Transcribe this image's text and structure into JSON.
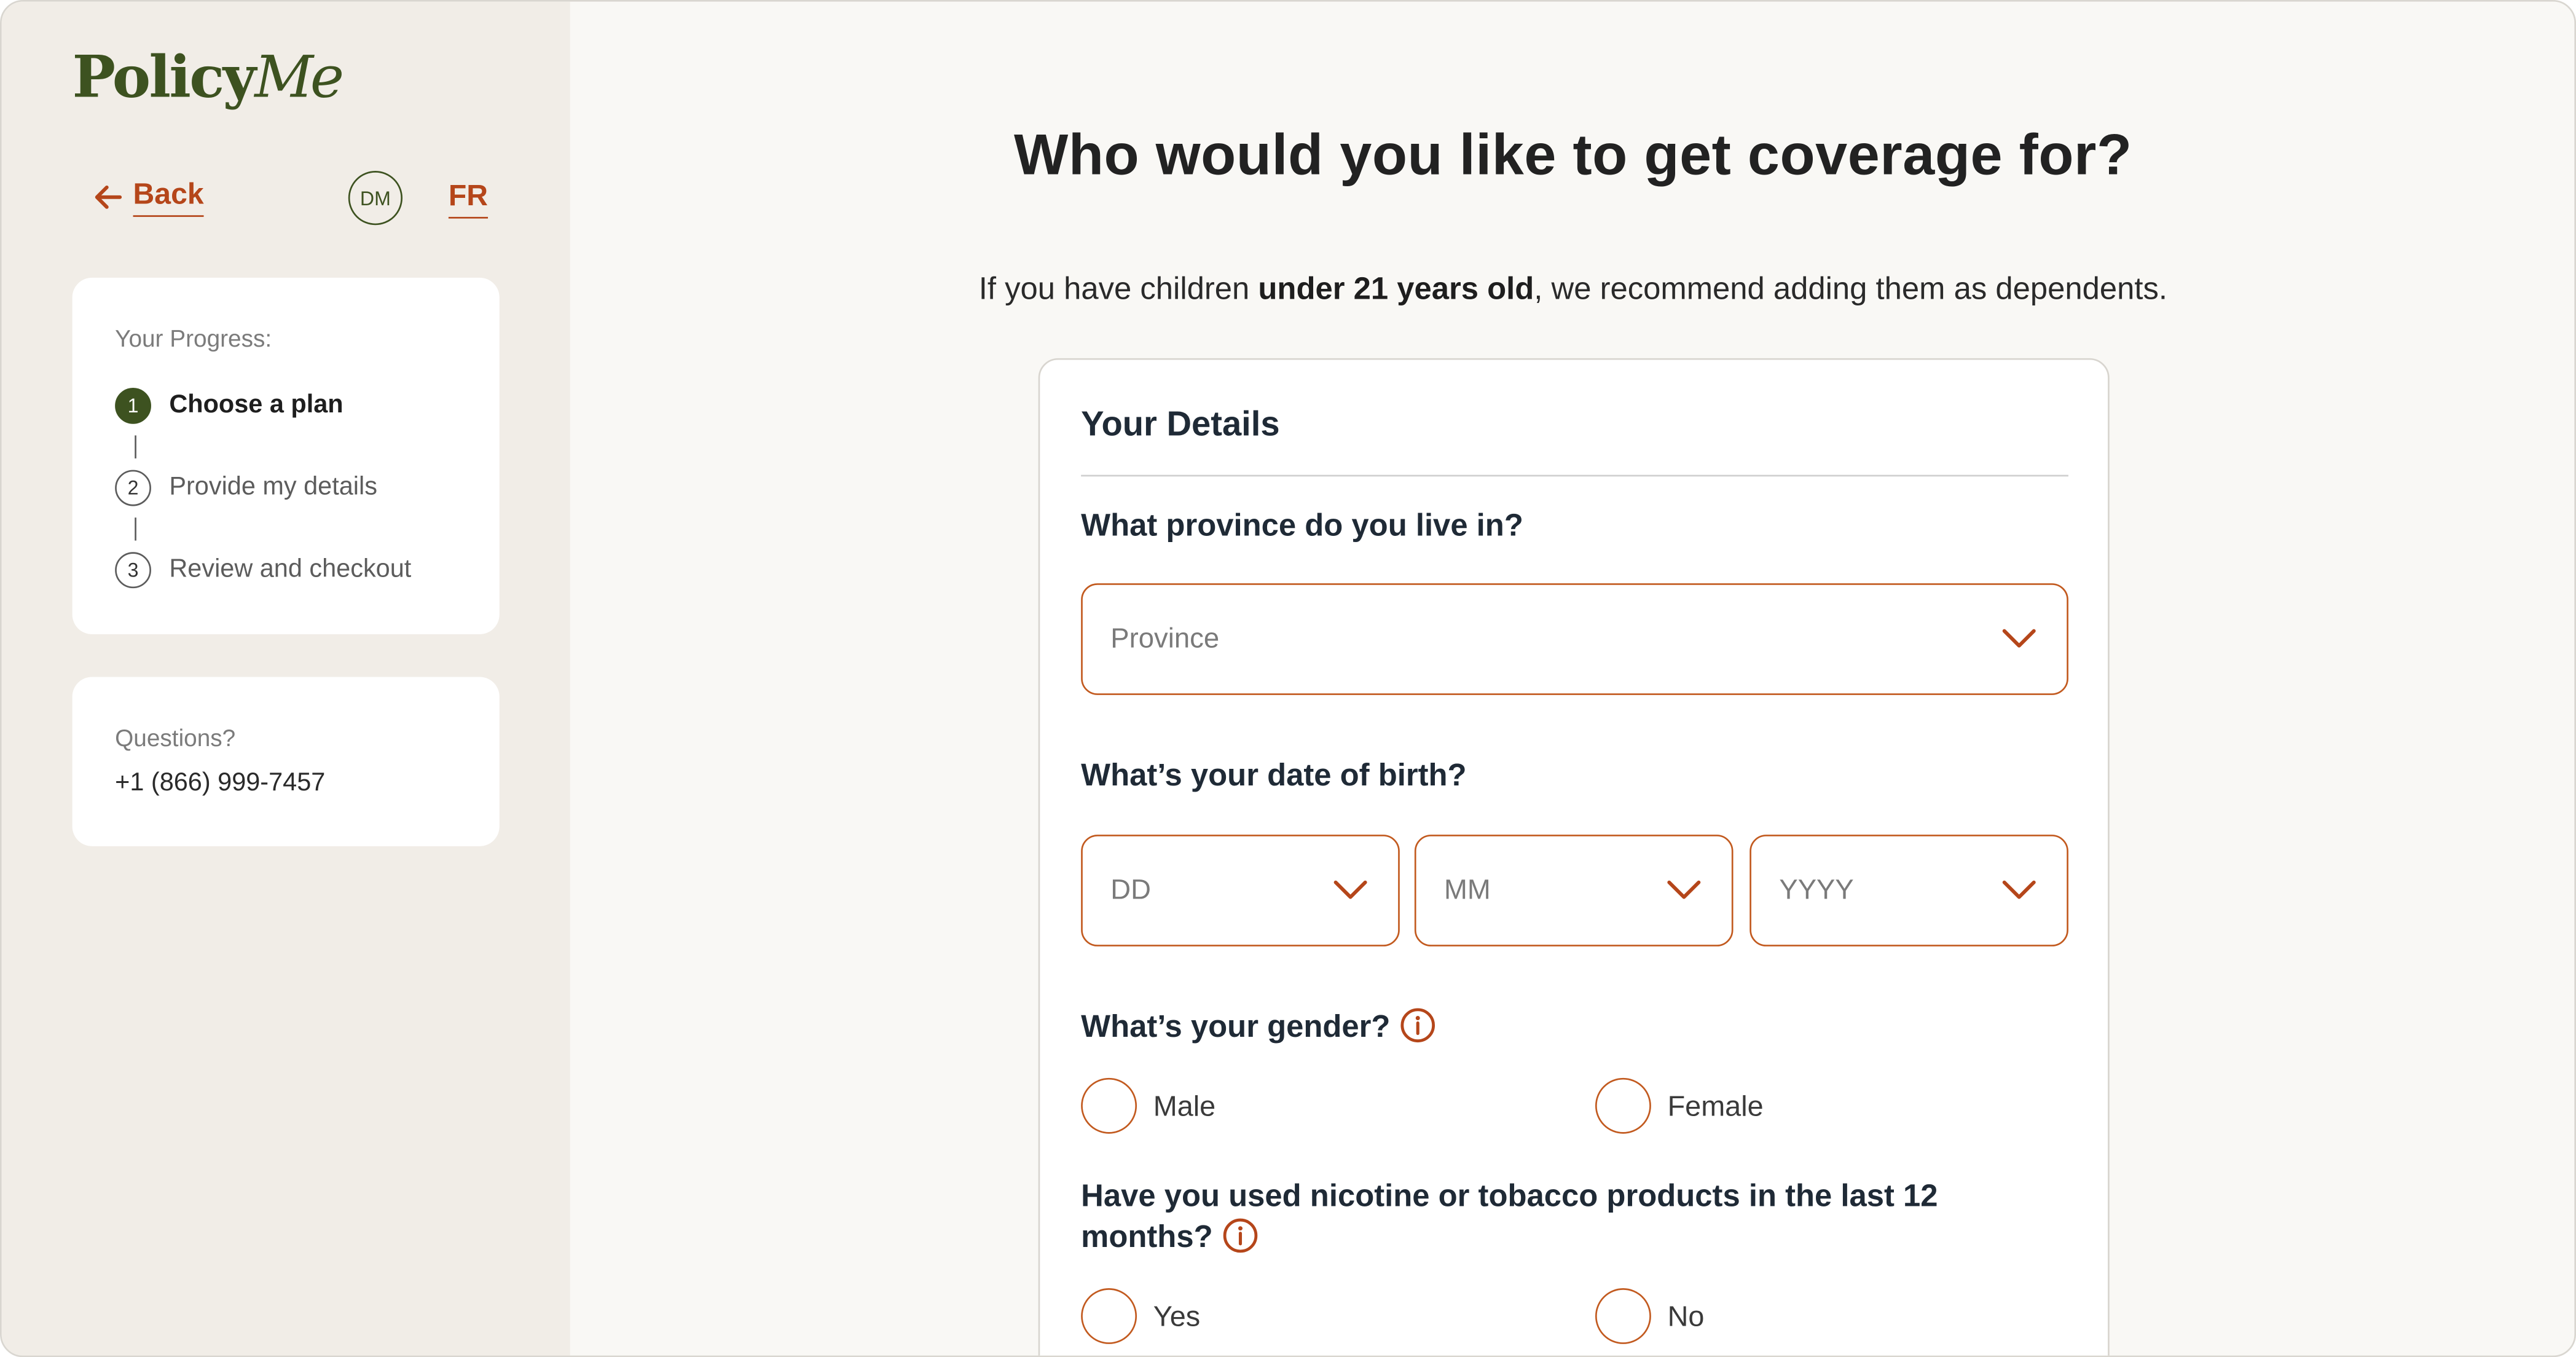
{
  "brand": {
    "logo_part1": "Policy",
    "logo_part2": "Me"
  },
  "nav": {
    "back_label": "Back",
    "avatar_initials": "DM",
    "language_toggle": "FR"
  },
  "progress": {
    "title": "Your Progress:",
    "steps": [
      {
        "number": "1",
        "label": "Choose a plan",
        "active": true
      },
      {
        "number": "2",
        "label": "Provide my details",
        "active": false
      },
      {
        "number": "3",
        "label": "Review and checkout",
        "active": false
      }
    ]
  },
  "questions": {
    "title": "Questions?",
    "phone": "+1 (866) 999-7457"
  },
  "main": {
    "title": "Who would you like to get coverage for?",
    "subtitle_prefix": "If you have children ",
    "subtitle_bold": "under 21 years old",
    "subtitle_suffix": ", we recommend adding them as dependents."
  },
  "form": {
    "heading": "Your Details",
    "province": {
      "label": "What province do you live in?",
      "placeholder": "Province"
    },
    "dob": {
      "label": "What’s your date of birth?",
      "day_placeholder": "DD",
      "month_placeholder": "MM",
      "year_placeholder": "YYYY"
    },
    "gender": {
      "label": "What’s your gender?",
      "options": [
        "Male",
        "Female"
      ]
    },
    "nicotine": {
      "label_line1": "Have you used nicotine or tobacco products in the last 12",
      "label_line2": "months?",
      "options": [
        "Yes",
        "No"
      ]
    }
  },
  "colors": {
    "accent": "#c25a1f",
    "brand_green": "#3d5220",
    "sidebar_bg": "#f1ede7",
    "page_bg": "#f9f8f5"
  }
}
